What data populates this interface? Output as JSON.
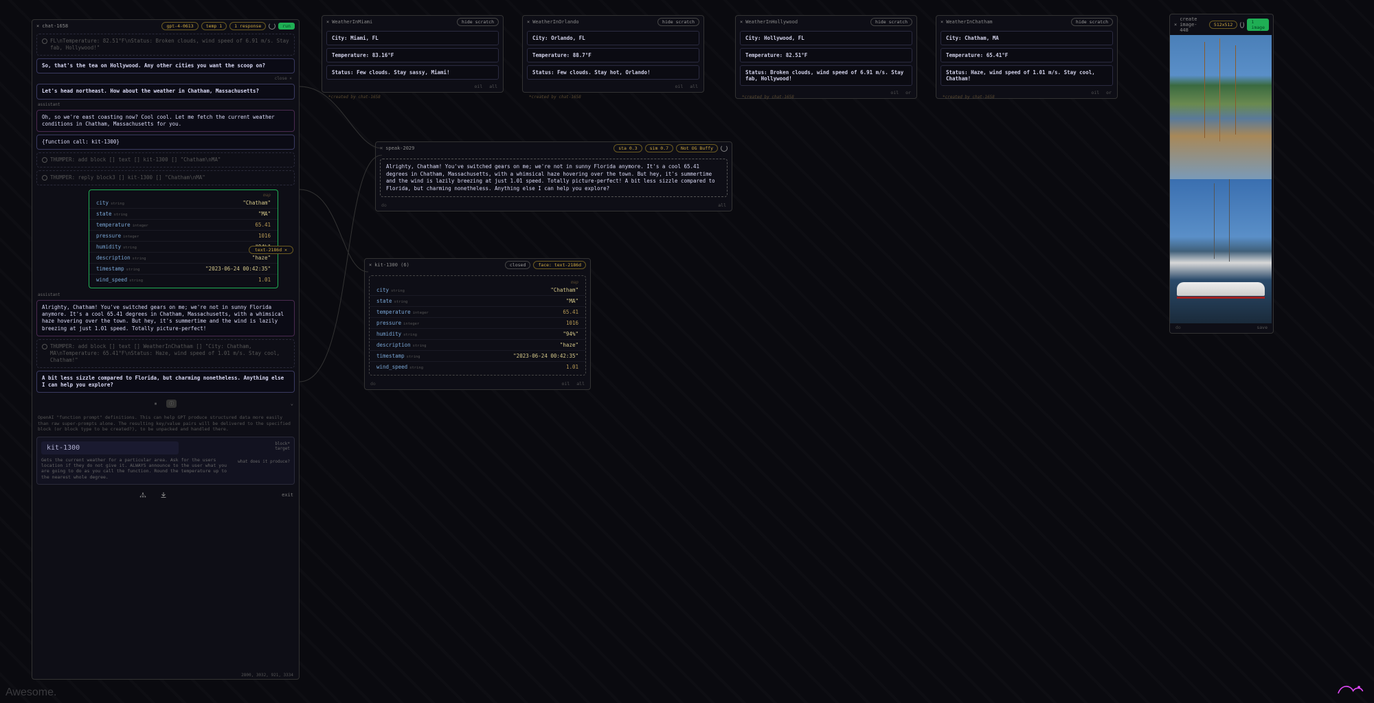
{
  "chat": {
    "title": "chat-1658",
    "pills": [
      "gpt-4-0613",
      "temp 1",
      "1 response"
    ],
    "run": "run",
    "truncated": "FL\\nTemperature: 82.51°F\\nStatus: Broken clouds, wind speed of 6.91 m/s. Stay fab, Hollywood!\"",
    "m1": "So, that's the tea on Hollywood. Any other cities you want the scoop on?",
    "u1": "Let's head northeast. How about the weather in Chatham, Massachusetts?",
    "a1_lbl": "assistant",
    "a1": "Oh, so we're east coasting now? Cool cool. Let me fetch the current weather conditions in Chatham, Massachusetts for you.",
    "fn": "{function call: kit-1300}",
    "t1": "THUMPER: add block [] text [] kit-1300 [] \"Chatham\\nMA\"",
    "t2": "THUMPER: reply block3 [] kit-1300 [] \"Chatham\\nMA\"",
    "a2_lbl": "assistant",
    "a2": "Alrighty, Chatham! You've switched gears on me; we're not in sunny Florida anymore. It's a cool 65.41 degrees in Chatham, Massachusetts, with a whimsical haze hovering over the town. But hey, it's summertime and the wind is lazily breezing at just 1.01 speed. Totally picture-perfect!",
    "t3": "THUMPER: add block [] text [] WeatherInChatham [] \"City: Chatham, MA\\nTemperature: 65.41°F\\nStatus: Haze, wind speed of 1.01 m/s. Stay cool, Chatham!\"",
    "m2": "A bit less sizzle compared to Florida, but charming nonetheless. Anything else I can help you explore?",
    "toolbar": {
      "pause": "⏸",
      "info": "ⓘ"
    },
    "desc": "OpenAI \"function prompt\" definitions. This can help GPT produce structured data more easily than raw super-prompts alone. The resulting key/value pairs will be delivered to the specified block (or block type to be created?), to be unpacked and handled there.",
    "kit": {
      "name": "kit-1300",
      "desc": "Gets the current weather for a particular area. Ask for the users location if they do not give it. ALWAYS announce to the user what you are going to do as you call the function. Round the temperature up to the nearest whole degree.",
      "block_lbl": "block*",
      "target_lbl": "target",
      "prod_lbl": "what does it produce?"
    },
    "close_lbl": "close ×",
    "exit": "exit",
    "coords": "2800, 3032, 921, 3334"
  },
  "weather_panels": [
    {
      "title": "WeatherInMiami",
      "lines": [
        "City: Miami, FL",
        "Temperature: 83.16°F",
        "Status: Few clouds. Stay sassy, Miami!"
      ],
      "hide": "hide scratch",
      "note": "*created by chat-1658"
    },
    {
      "title": "WeatherInOrlando",
      "lines": [
        "City: Orlando, FL",
        "Temperature: 88.7°F",
        "Status: Few clouds. Stay hot, Orlando!"
      ],
      "hide": "hide scratch",
      "note": "*created by chat-1658"
    },
    {
      "title": "WeatherInHollywood",
      "lines": [
        "City: Hollywood, FL",
        "Temperature: 82.51°F",
        "Status: Broken clouds, wind speed of 6.91 m/s. Stay fab, Hollywood!"
      ],
      "hide": "hide scratch",
      "note": "*created by chat-1658"
    },
    {
      "title": "WeatherInChatham",
      "lines": [
        "City: Chatham, MA",
        "Temperature: 65.41°F",
        "Status: Haze, wind speed of 1.01 m/s. Stay cool, Chatham!"
      ],
      "hide": "hide scratch",
      "note": "*created by chat-1658"
    }
  ],
  "speak": {
    "title": "speak-2029",
    "pills": [
      "sta 0.3",
      "sim 0.7",
      "Not OG Buffy"
    ],
    "body": "Alrighty, Chatham! You've switched gears on me; we're not in sunny Florida anymore. It's a cool 65.41 degrees in Chatham, Massachusetts, with a whimsical haze hovering over the town. But hey, it's summertime and the wind is lazily breezing at just 1.01 speed. Totally picture-perfect!   A bit less sizzle compared to Florida, but charming nonetheless. Anything else I can help you explore?"
  },
  "kit_card": {
    "title": "kit-1300 (6)",
    "pills": [
      "closed",
      "face: text-2186d"
    ]
  },
  "test_label": "text-2186d ×",
  "data_map": {
    "label": "map",
    "rows": [
      {
        "k": "city",
        "t": "string",
        "v": "\"Chatham\""
      },
      {
        "k": "state",
        "t": "string",
        "v": "\"MA\""
      },
      {
        "k": "temperature",
        "t": "integer",
        "v": "65.41"
      },
      {
        "k": "pressure",
        "t": "integer",
        "v": "1016"
      },
      {
        "k": "humidity",
        "t": "string",
        "v": "\"94%\""
      },
      {
        "k": "description",
        "t": "string",
        "v": "\"haze\""
      },
      {
        "k": "timestamp",
        "t": "string",
        "v": "\"2023-06-24 00:42:35\""
      },
      {
        "k": "wind_speed",
        "t": "string",
        "v": "1.01"
      }
    ]
  },
  "img_panel": {
    "title": "create image-448",
    "dim": "512x512",
    "badge": "1 image"
  },
  "footer": {
    "do": "do",
    "oil": "oil",
    "all": "all",
    "or": "or",
    "save": "save"
  },
  "awesome": "Awesome."
}
